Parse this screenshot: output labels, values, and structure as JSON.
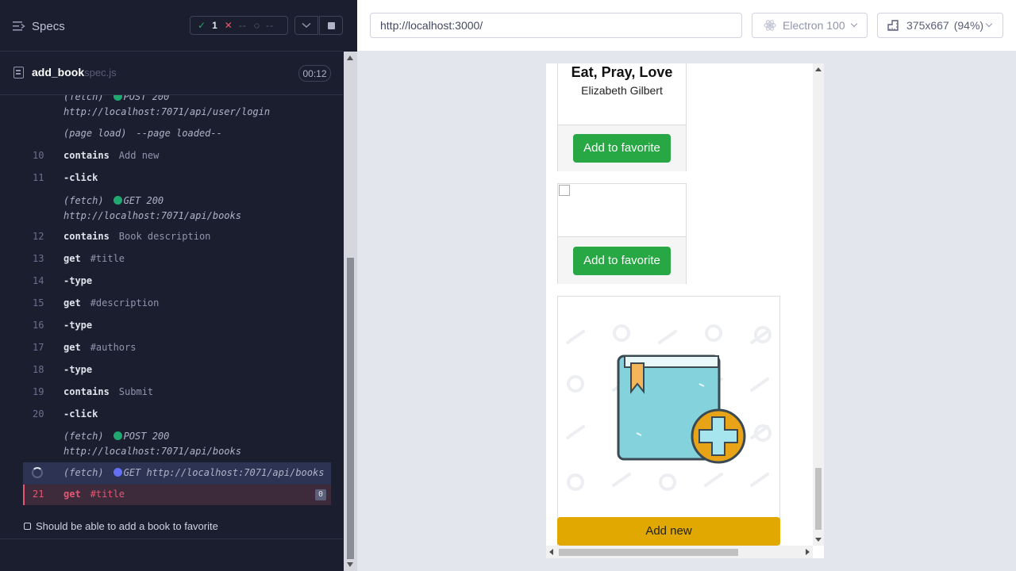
{
  "runner": {
    "specs_label": "Specs",
    "stats": {
      "passed": "1",
      "failed": "--",
      "pending": "--"
    },
    "spec": {
      "name": "add_book",
      "ext": "spec.js",
      "duration": "00:12"
    },
    "log": [
      {
        "kind": "event",
        "type": "(fetch)",
        "method": "POST 200",
        "url": "http://localhost:7071/api/user/login",
        "dot": "green"
      },
      {
        "kind": "event",
        "type": "(page load)",
        "message": "--page loaded--"
      },
      {
        "kind": "cmd",
        "num": "10",
        "name": "contains",
        "arg": "Add new"
      },
      {
        "kind": "cmd",
        "num": "11",
        "name": "-click",
        "arg": ""
      },
      {
        "kind": "event",
        "type": "(fetch)",
        "method": "GET 200",
        "url": "http://localhost:7071/api/books",
        "dot": "green"
      },
      {
        "kind": "cmd",
        "num": "12",
        "name": "contains",
        "arg": "Book description"
      },
      {
        "kind": "cmd",
        "num": "13",
        "name": "get",
        "arg": "#title"
      },
      {
        "kind": "cmd",
        "num": "14",
        "name": "-type",
        "arg": ""
      },
      {
        "kind": "cmd",
        "num": "15",
        "name": "get",
        "arg": "#description"
      },
      {
        "kind": "cmd",
        "num": "16",
        "name": "-type",
        "arg": ""
      },
      {
        "kind": "cmd",
        "num": "17",
        "name": "get",
        "arg": "#authors"
      },
      {
        "kind": "cmd",
        "num": "18",
        "name": "-type",
        "arg": ""
      },
      {
        "kind": "cmd",
        "num": "19",
        "name": "contains",
        "arg": "Submit"
      },
      {
        "kind": "cmd",
        "num": "20",
        "name": "-click",
        "arg": ""
      },
      {
        "kind": "event",
        "type": "(fetch)",
        "method": "POST 200",
        "url": "http://localhost:7071/api/books",
        "dot": "green"
      }
    ],
    "pending": {
      "type": "(fetch)",
      "text": "GET http://localhost:7071/api/books"
    },
    "failed": {
      "num": "21",
      "name": "get",
      "arg": "#title",
      "count": "0"
    },
    "test_title": "Should be able to add a book to favorite"
  },
  "aut": {
    "url": "http://localhost:3000/",
    "browser": "Electron 100",
    "viewport": "375x667",
    "scale": "(94%)",
    "book": {
      "title": "Eat, Pray, Love",
      "author": "Elizabeth Gilbert"
    },
    "fav_label": "Add to favorite",
    "add_new_label": "Add new"
  },
  "colors": {
    "pass": "#1fa971",
    "fail": "#e45770",
    "fav_button": "#28a745",
    "add_button": "#e0a800"
  }
}
